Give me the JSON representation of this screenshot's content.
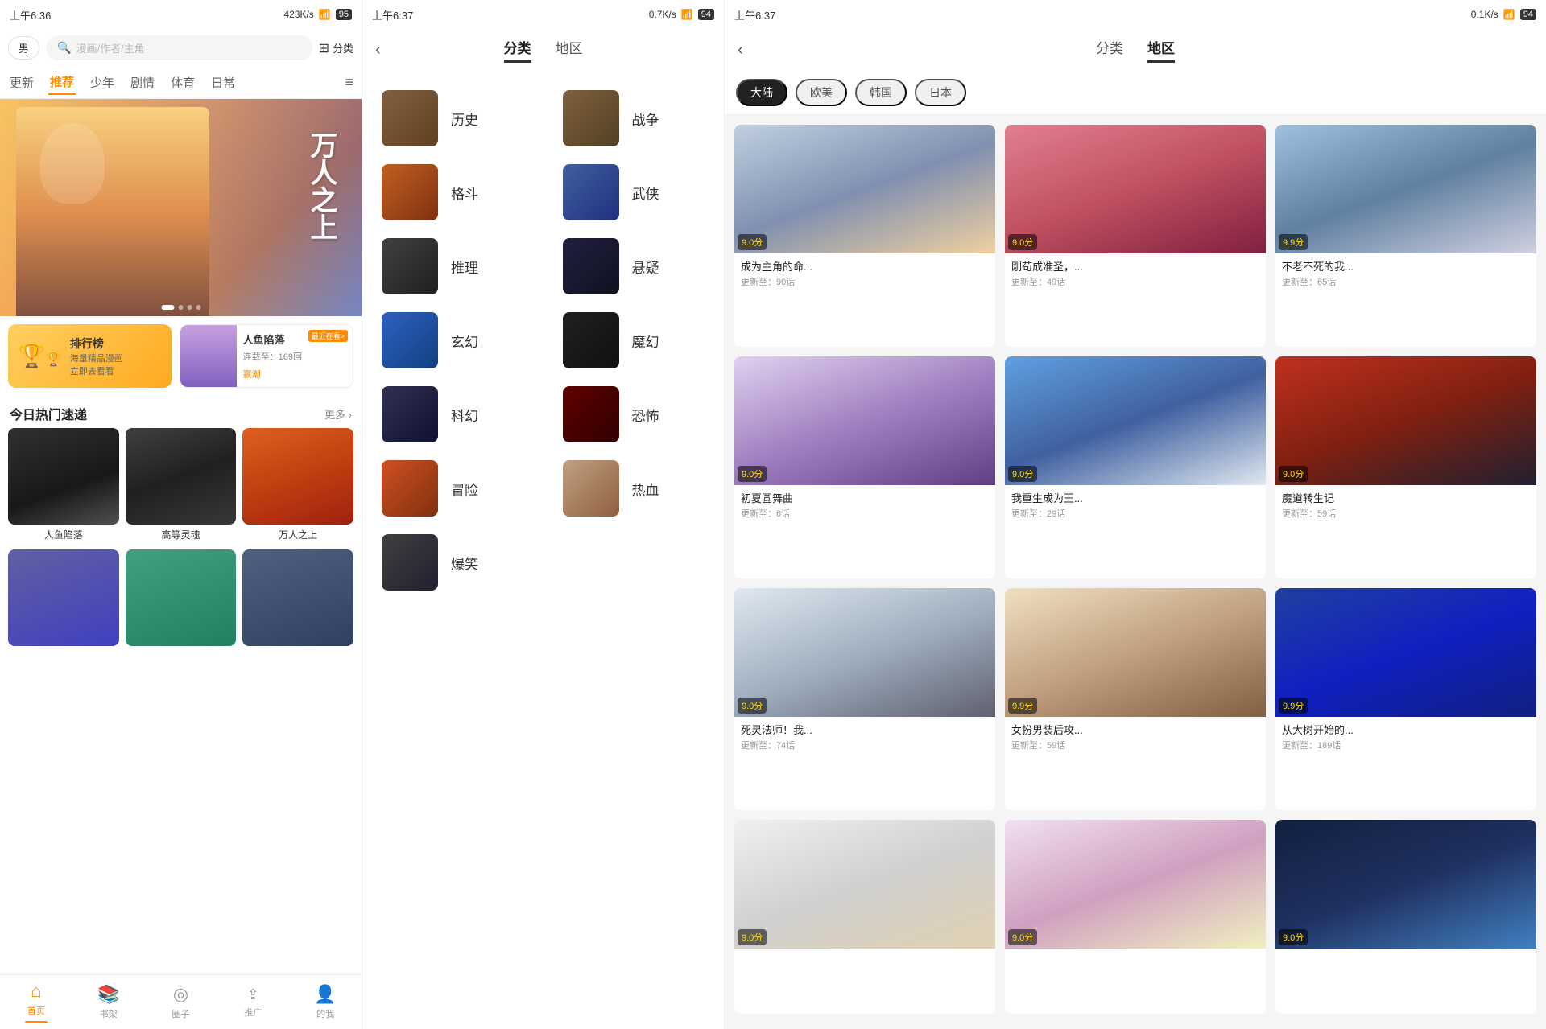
{
  "panels": {
    "home": {
      "status": {
        "time": "上午6:36",
        "speed": "423K/s",
        "battery": "95"
      },
      "search": {
        "gender": "男",
        "placeholder": "漫画/作者/主角",
        "classify": "分类"
      },
      "nav_tabs": [
        "更新",
        "推荐",
        "少年",
        "剧情",
        "体育",
        "日常"
      ],
      "active_tab": "推荐",
      "banner": {
        "title": "万人之上"
      },
      "ranking": {
        "title": "排行榜",
        "sub1": "海量精品漫画",
        "sub2": "立即去看看"
      },
      "recent": {
        "title": "人鱼陷落",
        "sub": "连载至：169回",
        "label": "最近在看>",
        "cta": "赢潮"
      },
      "today_hot": {
        "title": "今日热门速递",
        "more": "更多 ›",
        "items": [
          {
            "name": "人鱼陷落"
          },
          {
            "name": "高等灵魂"
          },
          {
            "name": "万人之上"
          }
        ],
        "items2": [
          {
            "name": ""
          },
          {
            "name": ""
          },
          {
            "name": ""
          }
        ]
      },
      "bottom_nav": [
        "首页",
        "书架",
        "圈子",
        "推广",
        "的我"
      ]
    },
    "category": {
      "status": {
        "time": "上午6:37",
        "speed": "0.7K/s",
        "battery": "94"
      },
      "header": {
        "back": "‹",
        "tabs": [
          "分类",
          "地区"
        ],
        "active": "分类"
      },
      "left_items": [
        {
          "label": "历史",
          "thumb": "cat-thumb-hist"
        },
        {
          "label": "格斗",
          "thumb": "cat-thumb-fight"
        },
        {
          "label": "推理",
          "thumb": "cat-thumb-reason"
        },
        {
          "label": "玄幻",
          "thumb": "cat-thumb-xuan"
        },
        {
          "label": "科幻",
          "thumb": "cat-thumb-scifi"
        },
        {
          "label": "冒险",
          "thumb": "cat-thumb-adv"
        },
        {
          "label": "爆笑",
          "thumb": "cat-thumb-comedy"
        }
      ],
      "right_items": [
        {
          "label": "战争",
          "thumb": "cat-thumb-war"
        },
        {
          "label": "武侠",
          "thumb": "cat-thumb-wuxia"
        },
        {
          "label": "悬疑",
          "thumb": "cat-thumb-mystery"
        },
        {
          "label": "魔幻",
          "thumb": "cat-thumb-magic"
        },
        {
          "label": "恐怖",
          "thumb": "cat-thumb-horror"
        },
        {
          "label": "热血",
          "thumb": "cat-thumb-hot"
        }
      ]
    },
    "region": {
      "status": {
        "time": "上午6:37",
        "speed": "0.1K/s",
        "battery": "94"
      },
      "header": {
        "back": "‹",
        "tabs": [
          "分类",
          "地区"
        ],
        "active": "地区"
      },
      "filters": [
        "大陆",
        "欧美",
        "韩国",
        "日本"
      ],
      "active_filter": "大陆",
      "mangas": [
        {
          "title": "成为主角的命...",
          "update": "更新至：90话",
          "score": "9.0分",
          "cover": "cover-c1"
        },
        {
          "title": "刚苟成准圣，...",
          "update": "更新至：49话",
          "score": "9.0分",
          "cover": "cover-c2"
        },
        {
          "title": "不老不死的我...",
          "update": "更新至：65话",
          "score": "9.9分",
          "cover": "cover-c3"
        },
        {
          "title": "初夏圆舞曲",
          "update": "更新至：6话",
          "score": "9.0分",
          "cover": "cover-c4"
        },
        {
          "title": "我重生成为王...",
          "update": "更新至：29话",
          "score": "9.0分",
          "cover": "cover-c5"
        },
        {
          "title": "魔道转生记",
          "update": "更新至：59话",
          "score": "9.0分",
          "cover": "cover-c6"
        },
        {
          "title": "死灵法师！我...",
          "update": "更新至：74话",
          "score": "9.0分",
          "cover": "cover-c7"
        },
        {
          "title": "女扮男装后攻...",
          "update": "更新至：59话",
          "score": "9.9分",
          "cover": "cover-c8"
        },
        {
          "title": "从大树开始的...",
          "update": "更新至：189话",
          "score": "9.9分",
          "cover": "cover-c9"
        },
        {
          "title": "",
          "update": "",
          "score": "9.0分",
          "cover": "cover-c10"
        },
        {
          "title": "",
          "update": "",
          "score": "9.0分",
          "cover": "cover-c11"
        },
        {
          "title": "",
          "update": "",
          "score": "9.0分",
          "cover": "cover-c12"
        }
      ]
    }
  }
}
